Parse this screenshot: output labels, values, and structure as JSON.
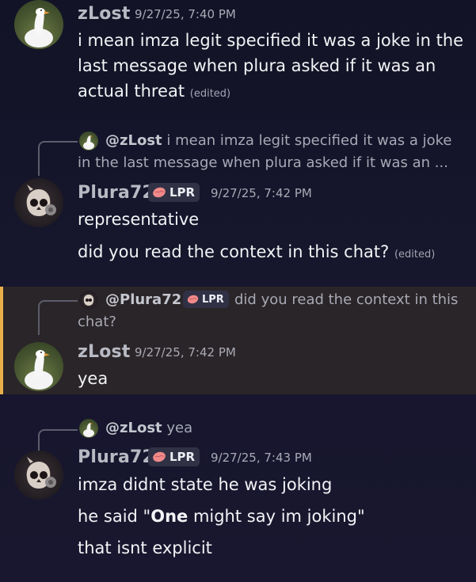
{
  "messages": [
    {
      "author": "zLost",
      "timestamp": "9/27/25, 7:40 PM",
      "lines": [
        "i mean imza legit specified it was a joke in the",
        "last message when plura asked if it was an",
        "actual threat"
      ],
      "edited": "(edited)"
    },
    {
      "reply": {
        "author": "@zLost",
        "line1": "i mean imza legit specified it was a joke",
        "line2": "in the last message when plura asked if it was an ..."
      },
      "author": "Plura72",
      "badge": "LPR",
      "timestamp": "9/27/25, 7:42 PM",
      "lines": [
        "representative"
      ]
    },
    {
      "author": "Plura72",
      "lines": [
        "did you read the context in this chat?"
      ],
      "edited": "(edited)"
    },
    {
      "reply": {
        "author": "@Plura72",
        "badge": "LPR",
        "line1": "did you read the context in this",
        "line2": "chat?"
      },
      "author": "zLost",
      "timestamp": "9/27/25, 7:42 PM",
      "lines": [
        "yea"
      ],
      "highlighted": true
    },
    {
      "reply": {
        "author": "@zLost",
        "line1": "yea"
      },
      "author": "Plura72",
      "badge": "LPR",
      "timestamp": "9/27/25, 7:43 PM",
      "lines": [
        "imza didnt state he was joking",
        "that isnt explicit"
      ],
      "quote_prefix": "he said \"",
      "quote_strong": "One",
      "quote_rest": " might say im joking\""
    }
  ],
  "colors": {
    "highlight_bar": "#e8b04a",
    "badge_bg": "#303145",
    "badge_icon": "#f08a8a"
  },
  "icons": {
    "badge_icon": "brain-icon",
    "goose_avatar": "goose-avatar",
    "plura_avatar": "skull-avatar"
  }
}
